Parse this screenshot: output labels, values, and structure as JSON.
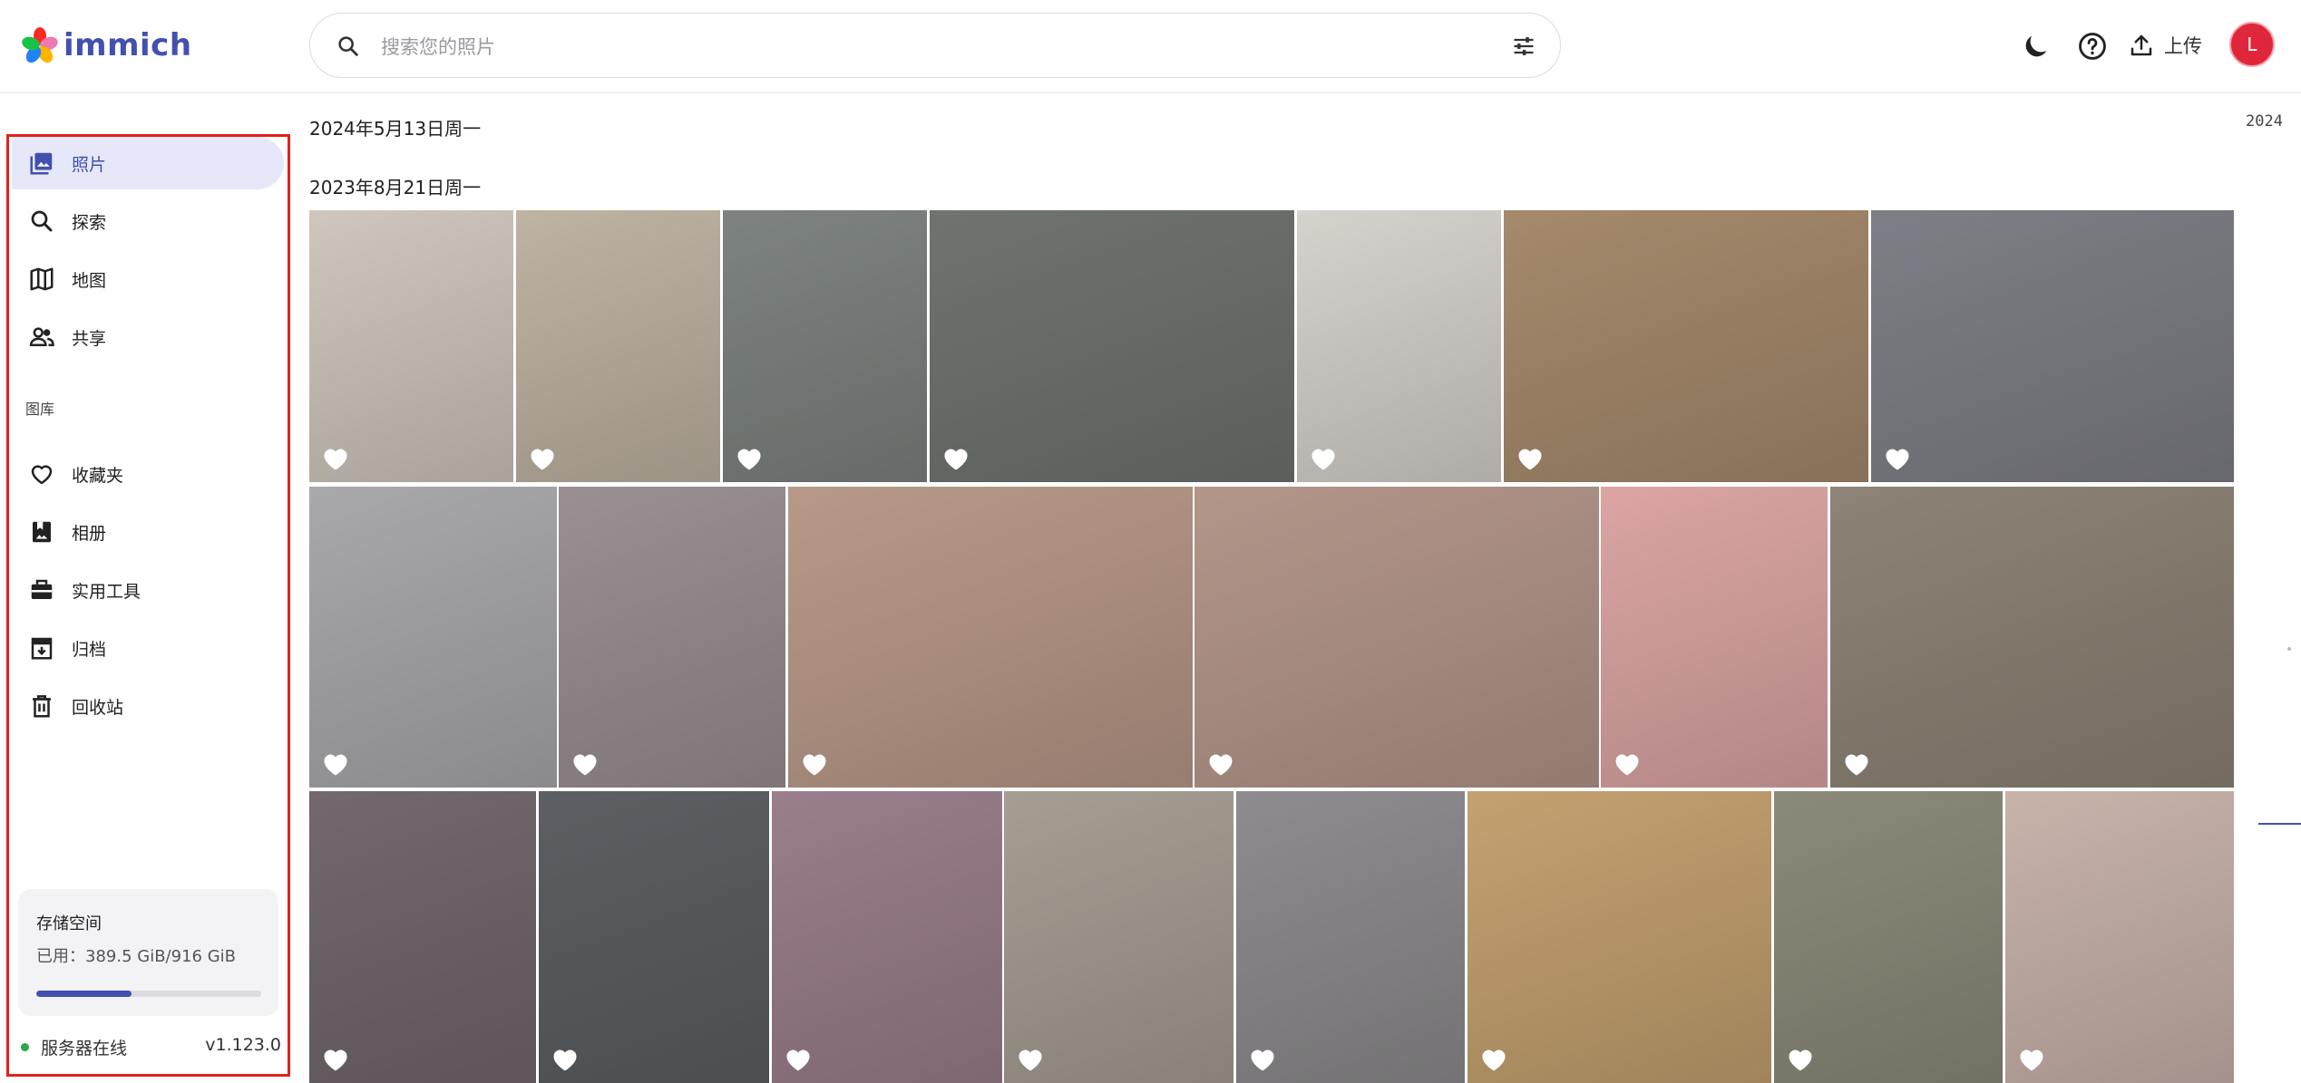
{
  "app": {
    "name": "immich"
  },
  "header": {
    "search_placeholder": "搜索您的照片",
    "upload_label": "上传",
    "avatar_initial": "L"
  },
  "sidebar": {
    "items": [
      {
        "label": "照片",
        "icon": "photos-icon",
        "active": true
      },
      {
        "label": "探索",
        "icon": "search-icon"
      },
      {
        "label": "地图",
        "icon": "map-icon"
      },
      {
        "label": "共享",
        "icon": "sharing-icon"
      }
    ],
    "library_label": "图库",
    "library_items": [
      {
        "label": "收藏夹",
        "icon": "heart-icon"
      },
      {
        "label": "相册",
        "icon": "album-icon"
      },
      {
        "label": "实用工具",
        "icon": "toolbox-icon"
      },
      {
        "label": "归档",
        "icon": "archive-icon"
      },
      {
        "label": "回收站",
        "icon": "trash-icon"
      }
    ],
    "storage": {
      "title": "存储空间",
      "used_text": "已用：389.5 GiB/916 GiB",
      "used_fraction": 0.425
    },
    "status": {
      "text": "服务器在线",
      "version": "v1.123.0",
      "color": "#26a943"
    }
  },
  "timeline": {
    "groups": [
      {
        "date": "2024年5月13日周一"
      },
      {
        "date": "2023年8月21日周一"
      }
    ],
    "year_label": "2024"
  },
  "colors": {
    "accent": "#4250af",
    "highlight_border": "#e3211c",
    "avatar": "#e0263a"
  }
}
